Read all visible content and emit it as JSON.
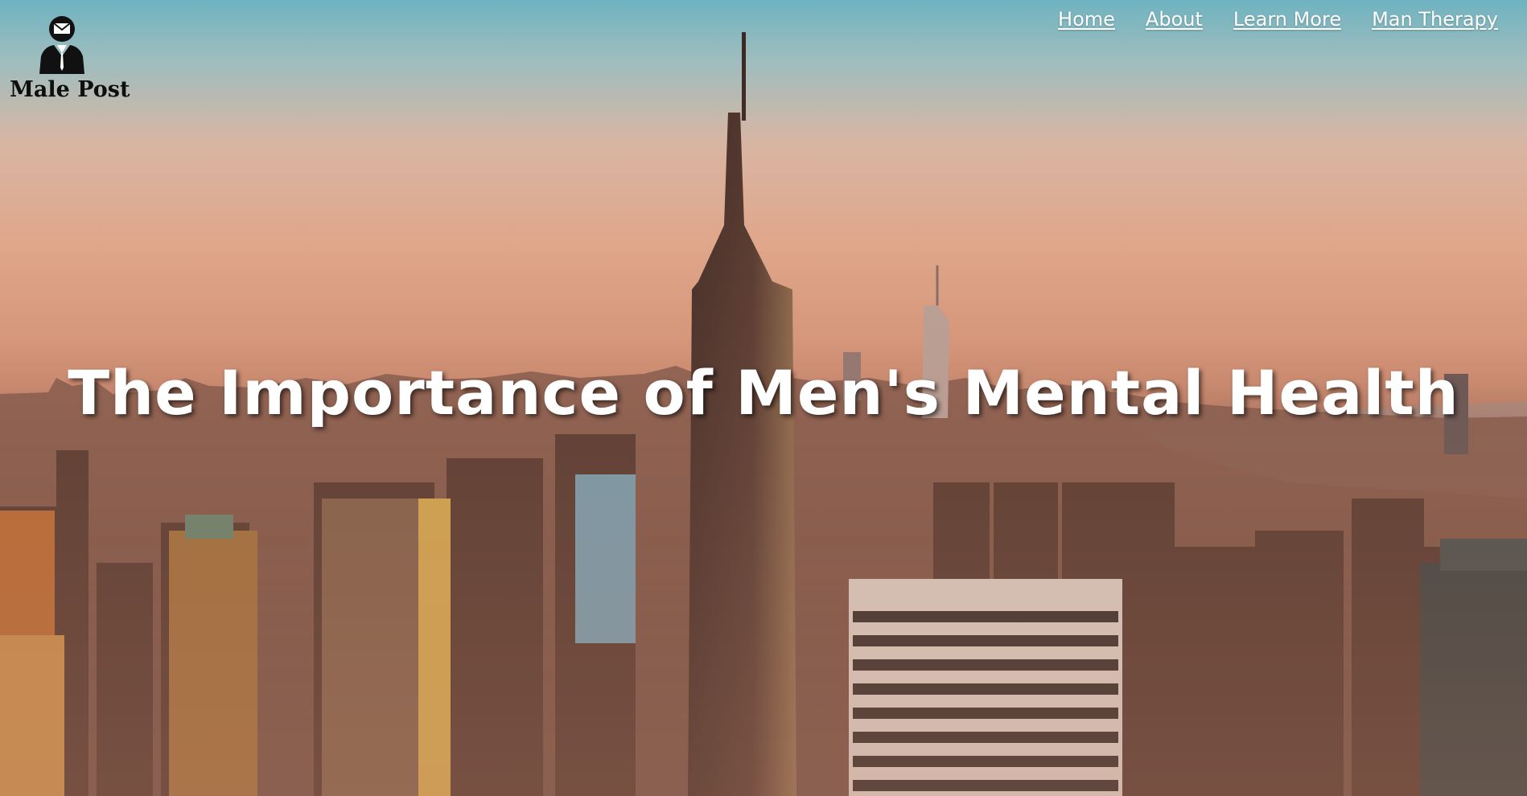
{
  "brand": {
    "name": "Male Post",
    "icon": "man-with-mail-icon"
  },
  "nav": {
    "items": [
      {
        "label": "Home"
      },
      {
        "label": "About"
      },
      {
        "label": "Learn More"
      },
      {
        "label": "Man Therapy"
      }
    ]
  },
  "hero": {
    "headline": "The Importance of Men's Mental Health",
    "background": "city-skyline-at-sunset-image"
  },
  "colors": {
    "headline_text": "#ffffff",
    "nav_text": "#ffffff",
    "brand_text": "#0f0f0f"
  }
}
